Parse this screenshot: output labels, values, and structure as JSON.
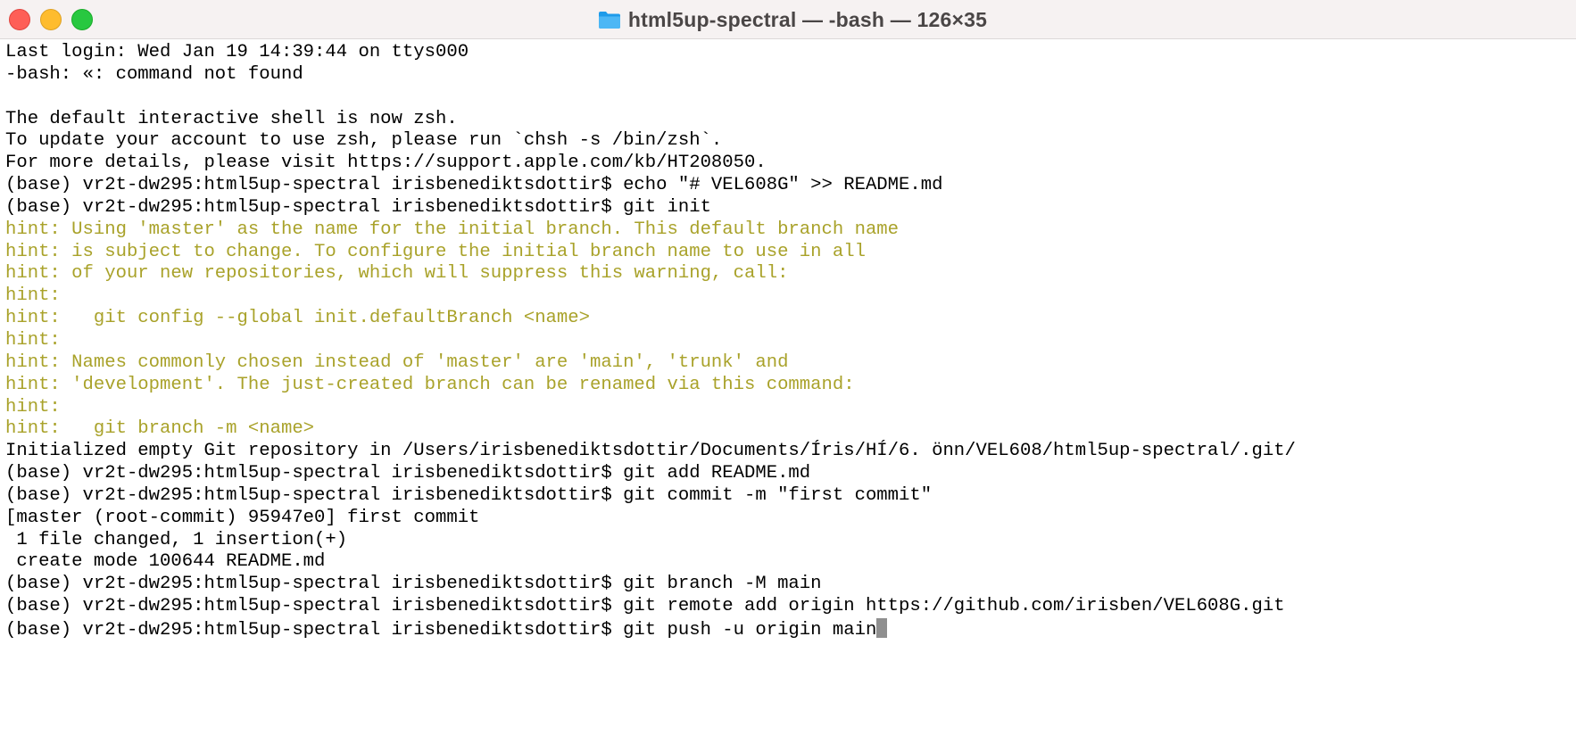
{
  "window": {
    "title": "html5up-spectral — -bash — 126×35",
    "folder_icon": "folder-icon",
    "buttons": {
      "close_icon": "close-icon",
      "minimize_icon": "minimize-icon",
      "zoom_icon": "zoom-icon"
    },
    "colors": {
      "close": "#fe5f57",
      "minimize": "#febc2e",
      "zoom": "#28c840",
      "hint_text": "#a9a22a"
    }
  },
  "terminal": {
    "lines": [
      {
        "type": "output",
        "text": "Last login: Wed Jan 19 14:39:44 on ttys000"
      },
      {
        "type": "output",
        "text": "-bash: «: command not found"
      },
      {
        "type": "output",
        "text": ""
      },
      {
        "type": "output",
        "text": "The default interactive shell is now zsh."
      },
      {
        "type": "output",
        "text": "To update your account to use zsh, please run `chsh -s /bin/zsh`."
      },
      {
        "type": "output",
        "text": "For more details, please visit https://support.apple.com/kb/HT208050."
      },
      {
        "type": "output",
        "text": "(base) vr2t-dw295:html5up-spectral irisbenediktsdottir$ echo \"# VEL608G\" >> README.md"
      },
      {
        "type": "output",
        "text": "(base) vr2t-dw295:html5up-spectral irisbenediktsdottir$ git init"
      },
      {
        "type": "hint",
        "text": "hint: Using 'master' as the name for the initial branch. This default branch name"
      },
      {
        "type": "hint",
        "text": "hint: is subject to change. To configure the initial branch name to use in all"
      },
      {
        "type": "hint",
        "text": "hint: of your new repositories, which will suppress this warning, call:"
      },
      {
        "type": "hint",
        "text": "hint:"
      },
      {
        "type": "hint",
        "text": "hint:   git config --global init.defaultBranch <name>"
      },
      {
        "type": "hint",
        "text": "hint:"
      },
      {
        "type": "hint",
        "text": "hint: Names commonly chosen instead of 'master' are 'main', 'trunk' and"
      },
      {
        "type": "hint",
        "text": "hint: 'development'. The just-created branch can be renamed via this command:"
      },
      {
        "type": "hint",
        "text": "hint:"
      },
      {
        "type": "hint",
        "text": "hint:   git branch -m <name>"
      },
      {
        "type": "output",
        "text": "Initialized empty Git repository in /Users/irisbenediktsdottir/Documents/Íris/HÍ/6. önn/VEL608/html5up-spectral/.git/"
      },
      {
        "type": "output",
        "text": "(base) vr2t-dw295:html5up-spectral irisbenediktsdottir$ git add README.md"
      },
      {
        "type": "output",
        "text": "(base) vr2t-dw295:html5up-spectral irisbenediktsdottir$ git commit -m \"first commit\""
      },
      {
        "type": "output",
        "text": "[master (root-commit) 95947e0] first commit"
      },
      {
        "type": "output",
        "text": " 1 file changed, 1 insertion(+)"
      },
      {
        "type": "output",
        "text": " create mode 100644 README.md"
      },
      {
        "type": "output",
        "text": "(base) vr2t-dw295:html5up-spectral irisbenediktsdottir$ git branch -M main"
      },
      {
        "type": "output",
        "text": "(base) vr2t-dw295:html5up-spectral irisbenediktsdottir$ git remote add origin https://github.com/irisben/VEL608G.git"
      }
    ],
    "prompt_line": {
      "text": "(base) vr2t-dw295:html5up-spectral irisbenediktsdottir$ git push -u origin main"
    }
  }
}
